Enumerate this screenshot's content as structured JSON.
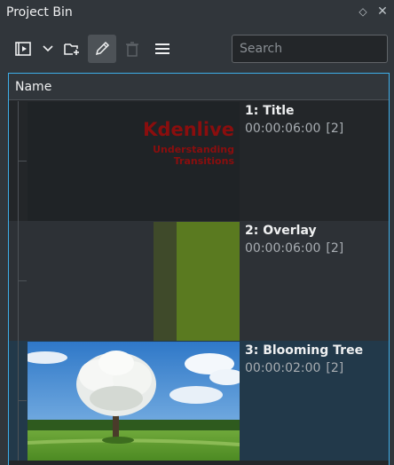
{
  "panel": {
    "title": "Project Bin",
    "float_icon": "diamond-float-icon",
    "close_icon": "close-icon"
  },
  "toolbar": {
    "buttons": [
      {
        "name": "add-clip",
        "icon": "film-icon"
      },
      {
        "name": "menu-dropdown",
        "icon": "chevron-down-icon"
      },
      {
        "name": "add-folder",
        "icon": "folder-plus-icon"
      },
      {
        "name": "edit",
        "icon": "pencil-icon",
        "active": true
      },
      {
        "name": "delete",
        "icon": "trash-icon",
        "disabled": true
      },
      {
        "name": "menu",
        "icon": "hamburger-icon"
      }
    ]
  },
  "search": {
    "placeholder": "Search",
    "value": ""
  },
  "tree": {
    "column_header": "Name",
    "clips": [
      {
        "name": "1: Title",
        "duration": "00:00:06:00",
        "usage": "[2]",
        "thumb_text": [
          "Kdenlive",
          "Understanding",
          "Transitions"
        ]
      },
      {
        "name": "2: Overlay",
        "duration": "00:00:06:00",
        "usage": "[2]"
      },
      {
        "name": "3: Blooming Tree",
        "duration": "00:00:02:00",
        "usage": "[2]"
      }
    ]
  },
  "colors": {
    "accent": "#3daee9",
    "background": "#31363b",
    "title_text": "#8a0e0e",
    "overlay_green": "#5a7a20"
  }
}
